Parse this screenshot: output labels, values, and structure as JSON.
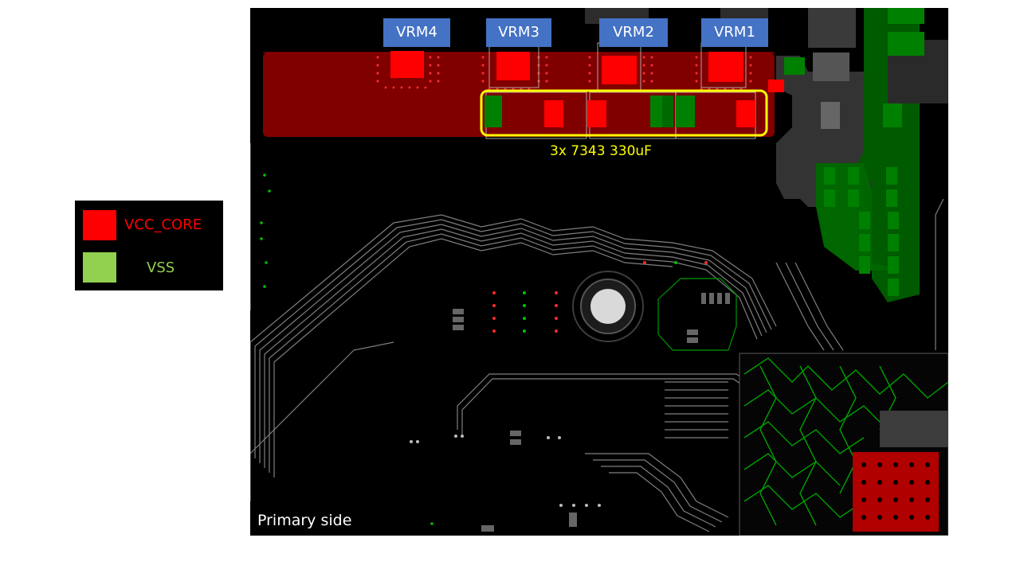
{
  "legend": {
    "items": [
      {
        "label": "VCC_CORE",
        "color": "#ff0000",
        "text_color": "#ff0000"
      },
      {
        "label": "VSS",
        "color": "#92d050",
        "text_color": "#92d050"
      }
    ]
  },
  "board": {
    "vrm_labels": [
      "VRM4",
      "VRM3",
      "VRM2",
      "VRM1"
    ],
    "capacitor_annotation": "3x 7343  330uF",
    "side_label": "Primary side",
    "colors": {
      "plane": "#800000",
      "pad_red": "#ff0000",
      "pad_green": "#008000",
      "trace_gray": "#7f7f7f",
      "highlight": "#ffff00",
      "label_bg": "#4472c4"
    }
  }
}
